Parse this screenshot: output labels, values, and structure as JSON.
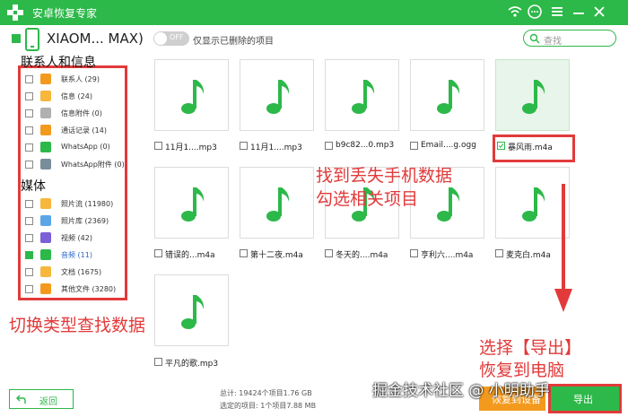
{
  "app": {
    "title": "安卓恢复专家"
  },
  "colors": {
    "brand": "#2db84a",
    "accent": "#f39a1e",
    "annotation": "#e23a3a"
  },
  "device": {
    "name": "XIAOM... MAX)"
  },
  "toggle": {
    "state": "OFF",
    "label": "仅显示已删除的项目"
  },
  "search": {
    "placeholder": "查找"
  },
  "sidebar": {
    "group1": "联系人和信息",
    "group2": "媒体",
    "items": [
      {
        "label": "联系人 (29)",
        "icon": "contacts-icon",
        "color": "#f39a1e",
        "checked": false
      },
      {
        "label": "信息 (24)",
        "icon": "message-icon",
        "color": "#f6b73c",
        "checked": false
      },
      {
        "label": "信息附件 (0)",
        "icon": "attachment-icon",
        "color": "#b0b0b0",
        "checked": false
      },
      {
        "label": "通话记录 (14)",
        "icon": "call-log-icon",
        "color": "#f39a1e",
        "checked": false
      },
      {
        "label": "WhatsApp (0)",
        "icon": "whatsapp-icon",
        "color": "#2db84a",
        "checked": false
      },
      {
        "label": "WhatsApp附件 (0)",
        "icon": "whatsapp-attachment-icon",
        "color": "#7a8d9a",
        "checked": false
      },
      {
        "label": "照片流 (11980)",
        "icon": "photo-stream-icon",
        "color": "#f6b73c",
        "checked": false
      },
      {
        "label": "照片库 (2369)",
        "icon": "photo-library-icon",
        "color": "#5aa5e6",
        "checked": false
      },
      {
        "label": "视频 (42)",
        "icon": "video-icon",
        "color": "#7b5fd6",
        "checked": false
      },
      {
        "label": "音频 (11)",
        "icon": "audio-icon",
        "color": "#2db84a",
        "checked": true
      },
      {
        "label": "文档 (1675)",
        "icon": "document-icon",
        "color": "#f6b73c",
        "checked": false
      },
      {
        "label": "其他文件 (3280)",
        "icon": "other-files-icon",
        "color": "#f39a1e",
        "checked": false
      }
    ]
  },
  "files": [
    {
      "name": "11月1....mp3",
      "checked": false
    },
    {
      "name": "11月1....mp3",
      "checked": false
    },
    {
      "name": "b9c82...0.mp3",
      "checked": false
    },
    {
      "name": "Email....g.ogg",
      "checked": false
    },
    {
      "name": "暴风雨.m4a",
      "checked": true
    },
    {
      "name": "错误的...m4a",
      "checked": false
    },
    {
      "name": "第十二夜.m4a",
      "checked": false
    },
    {
      "name": "冬天的....m4a",
      "checked": false
    },
    {
      "name": "亨利六....m4a",
      "checked": false
    },
    {
      "name": "麦克白.m4a",
      "checked": false
    },
    {
      "name": "平凡的歌.mp3",
      "checked": false
    }
  ],
  "annotations": {
    "find_line1": "找到丢失手机数据",
    "find_line2": "勾选相关项目",
    "switch": "切换类型查找数据",
    "export_line1": "选择【导出】",
    "export_line2": "恢复到电脑"
  },
  "footer": {
    "back": "返回",
    "total": "总计: 19424个项目1.76 GB",
    "selected": "选定的项目: 1个项目7.88 MB",
    "recover": "恢复到设备",
    "export": "导出"
  },
  "watermark": "掘金技术社区 @ 小明助手"
}
